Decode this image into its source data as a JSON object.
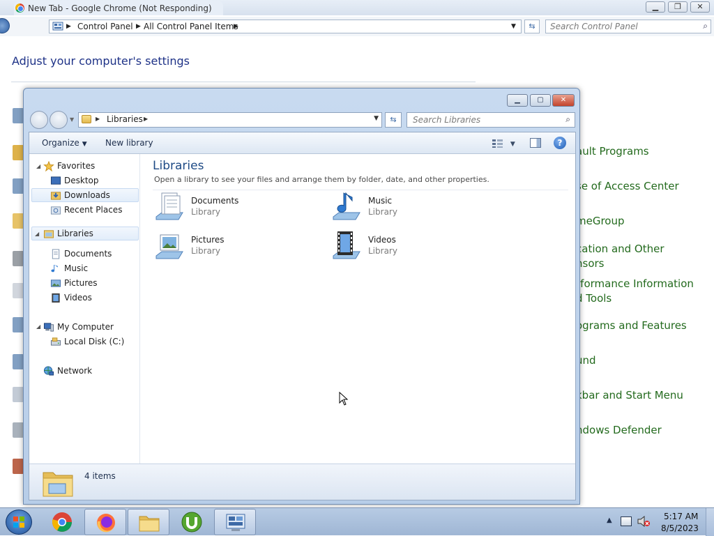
{
  "control_panel": {
    "tab_title": "New Tab - Google Chrome (Not Responding)",
    "breadcrumbs": [
      "Control Panel",
      "All Control Panel Items"
    ],
    "search_placeholder": "Search Control Panel",
    "heading": "Adjust your computer's settings",
    "links": [
      "ault Programs",
      "se of Access Center",
      "meGroup",
      "cation and Other",
      "nsors",
      "rformance Information",
      "d Tools",
      "ograms and Features",
      "und",
      "kbar and Start Menu",
      "ndows Defender"
    ]
  },
  "libraries_window": {
    "breadcrumb": "Libraries",
    "search_placeholder": "Search Libraries",
    "toolbar": {
      "organize_label": "Organize",
      "new_library_label": "New library"
    },
    "nav": {
      "favorites": "Favorites",
      "desktop": "Desktop",
      "downloads": "Downloads",
      "recent_places": "Recent Places",
      "libraries": "Libraries",
      "documents": "Documents",
      "music": "Music",
      "pictures": "Pictures",
      "videos": "Videos",
      "my_computer": "My Computer",
      "local_disk": "Local Disk (C:)",
      "network": "Network"
    },
    "content": {
      "title": "Libraries",
      "description": "Open a library to see your files and arrange them by folder, date, and other properties.",
      "items": [
        {
          "name": "Documents",
          "type": "Library",
          "icon": "documents-library-icon"
        },
        {
          "name": "Music",
          "type": "Library",
          "icon": "music-library-icon"
        },
        {
          "name": "Pictures",
          "type": "Library",
          "icon": "pictures-library-icon"
        },
        {
          "name": "Videos",
          "type": "Library",
          "icon": "videos-library-icon"
        }
      ]
    },
    "details_count": "4 items"
  },
  "taskbar": {
    "apps": [
      "chrome-icon",
      "firefox-icon",
      "file-explorer-icon",
      "utorrent-icon",
      "control-panel-icon"
    ],
    "clock_time": "5:17 AM",
    "clock_date": "8/5/2023"
  },
  "colors": {
    "link_green": "#236a1d",
    "heading_blue": "#1e3287",
    "content_title_blue": "#1e4a85",
    "taskbar_blue": "#b7cbe4"
  }
}
